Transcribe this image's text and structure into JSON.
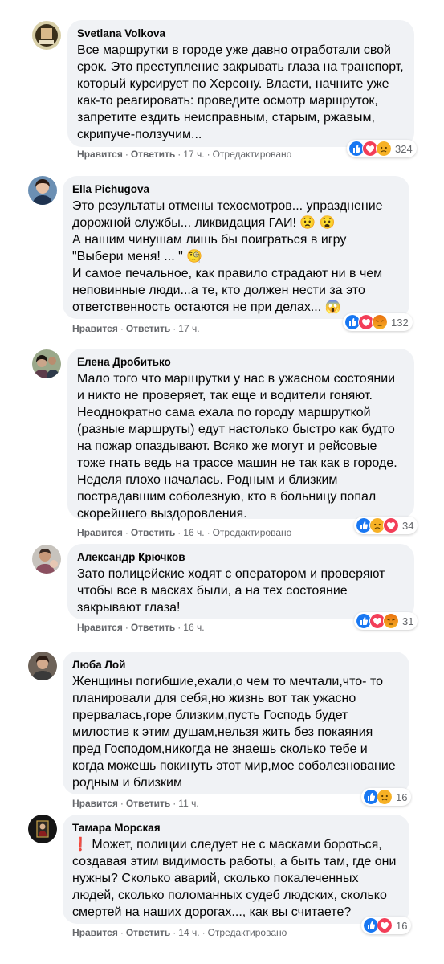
{
  "labels": {
    "like": "Нравится",
    "reply": "Ответить",
    "edited": "Отредактировано"
  },
  "comments": [
    {
      "author": "Svetlana Volkova",
      "text": "Все маршрутки в городе уже давно отработали свой\nсрок. Это преступление закрывать глаза на транспорт,\nкоторый курсирует по Херсону. Власти, начните уже\nкак-то реагировать: проведите осмотр маршруток,\nзапретите ездить неисправным, старым, ржавым,\nскрипуче-ползучим...",
      "time": "17 ч.",
      "edited": true,
      "reactions": [
        "like-icon",
        "love-icon",
        "sad-icon"
      ],
      "count": "324"
    },
    {
      "author": "Ella Pichugova",
      "text": "Это результаты отмены техосмотров... упразднение\nдорожной службы... ликвидация ГАИ! 😟 😧\nА нашим чинушам лишь бы поиграться в игру\n\"Выбери меня! ... \" 🧐\nИ самое печальное, как правило страдают ни в чем\nнеповинные люди...а те, кто должен нести за это\nответственность остаются не при делах... 😱",
      "time": "17 ч.",
      "edited": false,
      "reactions": [
        "like-icon",
        "love-icon",
        "angry-icon"
      ],
      "count": "132"
    },
    {
      "author": "Елена Дробитько",
      "text": "Мало того что маршрутки у нас в ужасном состоянии\nи никто не проверяет, так еще и водители гоняют.\nНеоднократно сама ехала по городу маршруткой\n(разные маршруты) едут настолько быстро как будто\nна пожар опаздывают. Всяко же могут и рейсовые\nтоже гнать ведь на трассе машин не так как в городе.\nНеделя плохо началась. Родным и близким\nпострадавшим соболезную, кто в больницу попал\nскорейшего выздоровления.",
      "time": "16 ч.",
      "edited": true,
      "reactions": [
        "like-icon",
        "sad-icon",
        "love-icon"
      ],
      "count": "34"
    },
    {
      "author": "Александр Крючков",
      "text": "Зато полицейские ходят с оператором и проверяют\nчтобы все в масках были, а на тех состояние\nзакрывают глаза!",
      "time": "16 ч.",
      "edited": false,
      "reactions": [
        "like-icon",
        "love-icon",
        "angry-icon"
      ],
      "count": "31"
    },
    {
      "author": "Люба Лой",
      "text": "Женщины погибшие,ехали,о чем то мечтали,что- то\nпланировали для себя,но жизнь вот так ужасно\nпрервалась,горе близким,пусть Господь будет\nмилостив к этим душам,нельзя жить без покаяния\nпред Господом,никогда не знаешь сколько тебе и\nкогда можешь покинуть этот мир,мое соболезнование\nродным и близким",
      "time": "11 ч.",
      "edited": false,
      "reactions": [
        "like-icon",
        "sad-icon"
      ],
      "count": "16"
    },
    {
      "author": "Тамара Морская",
      "text": "❗ Может, полиции следует не с масками бороться,\nсоздавая этим видимость работы, а быть там, где они\nнужны? Сколько аварий, сколько покалеченных\nлюдей, сколько поломанных судеб людских, сколько\nсмертей на наших дорогах..., как вы считаете?",
      "time": "14 ч.",
      "edited": true,
      "reactions": [
        "like-icon",
        "love-icon"
      ],
      "count": "16"
    }
  ]
}
